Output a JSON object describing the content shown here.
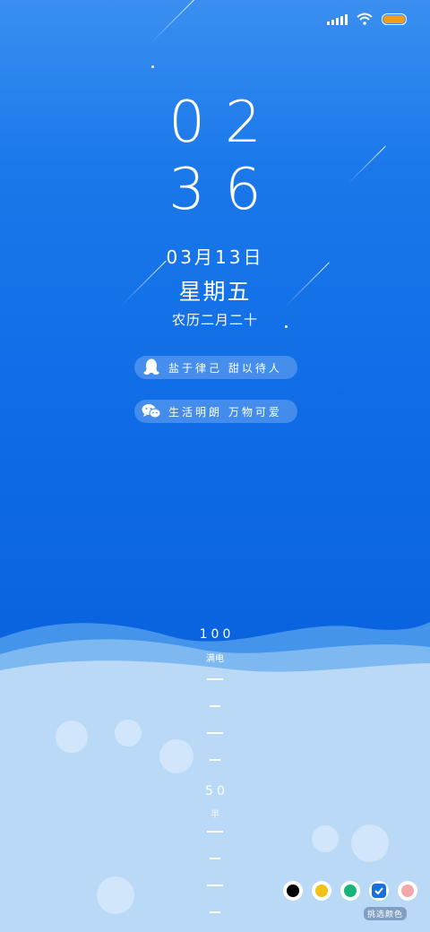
{
  "status": {
    "battery_color": "#f59a1c"
  },
  "clock": {
    "hour": "02",
    "minute": "36"
  },
  "date": "03月13日",
  "weekday": "星期五",
  "lunar": "农历二月二十",
  "social": [
    {
      "icon": "qq-icon",
      "text": "盐于律己 甜以待人"
    },
    {
      "icon": "wechat-icon",
      "text": "生活明朗 万物可爱"
    }
  ],
  "battery_scale": {
    "level": 100,
    "top_label": "100",
    "top_sub": "满电",
    "mid_label": "50",
    "mid_sub": "半"
  },
  "colors": {
    "swatches": [
      "#000000",
      "#f2c218",
      "#18b57a",
      "#1a6fe0",
      "#f4a9a9"
    ],
    "selected_index": 3,
    "pick_label": "挑选颜色"
  }
}
